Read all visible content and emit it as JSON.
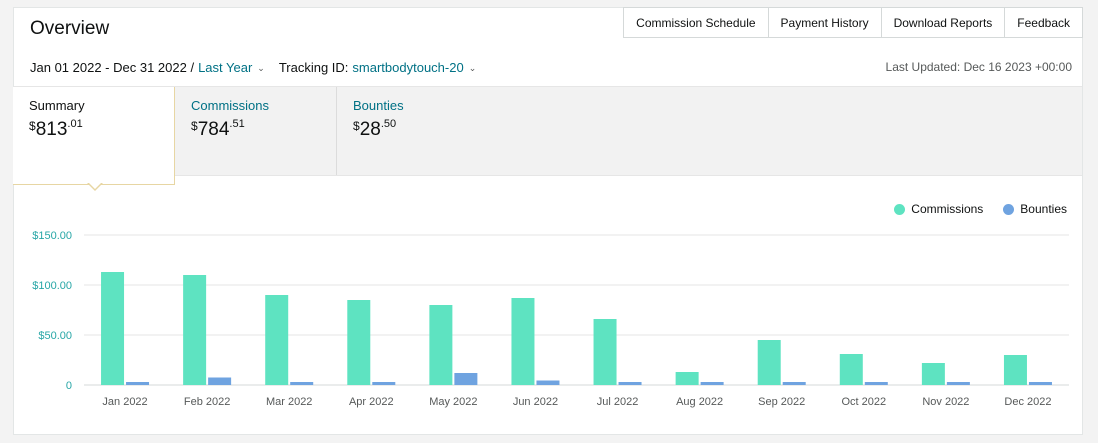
{
  "header": {
    "title": "Overview",
    "tabs": [
      {
        "label": "Commission Schedule"
      },
      {
        "label": "Payment History"
      },
      {
        "label": "Download Reports"
      },
      {
        "label": "Feedback"
      }
    ]
  },
  "filters": {
    "date_range": "Jan 01 2022 - Dec 31 2022 / ",
    "period_link": "Last Year",
    "tracking_label": "Tracking ID: ",
    "tracking_id": "smartbodytouch-20",
    "last_updated": "Last Updated: Dec 16 2023 +00:00"
  },
  "metrics": {
    "summary": {
      "label": "Summary",
      "currency": "$",
      "whole": "813",
      "cents": ".01"
    },
    "commissions": {
      "label": "Commissions",
      "currency": "$",
      "whole": "784",
      "cents": ".51"
    },
    "bounties": {
      "label": "Bounties",
      "currency": "$",
      "whole": "28",
      "cents": ".50"
    }
  },
  "icons": {
    "chevron": "chevron-down-icon"
  },
  "colors": {
    "commissions": "#5ee3c1",
    "bounties": "#6fa3e0",
    "link": "#007185",
    "grid": "#e6e6e6",
    "ytick": "#27a6a6"
  },
  "chart_data": {
    "type": "bar",
    "categories": [
      "Jan 2022",
      "Feb 2022",
      "Mar 2022",
      "Apr 2022",
      "May 2022",
      "Jun 2022",
      "Jul 2022",
      "Aug 2022",
      "Sep 2022",
      "Oct 2022",
      "Nov 2022",
      "Dec 2022"
    ],
    "series": [
      {
        "name": "Commissions",
        "values": [
          113,
          110,
          90,
          85,
          80,
          87,
          66,
          13,
          45,
          31,
          22,
          30
        ]
      },
      {
        "name": "Bounties",
        "values": [
          3,
          7.5,
          3,
          3,
          12,
          4.5,
          3,
          3,
          3,
          3,
          3,
          3
        ]
      }
    ],
    "yticks": [
      0,
      50,
      100,
      150
    ],
    "ytick_labels": [
      "0",
      "$50.00",
      "$100.00",
      "$150.00"
    ],
    "ylim": [
      0,
      150
    ],
    "grid": true,
    "legend_position": "top-right"
  }
}
